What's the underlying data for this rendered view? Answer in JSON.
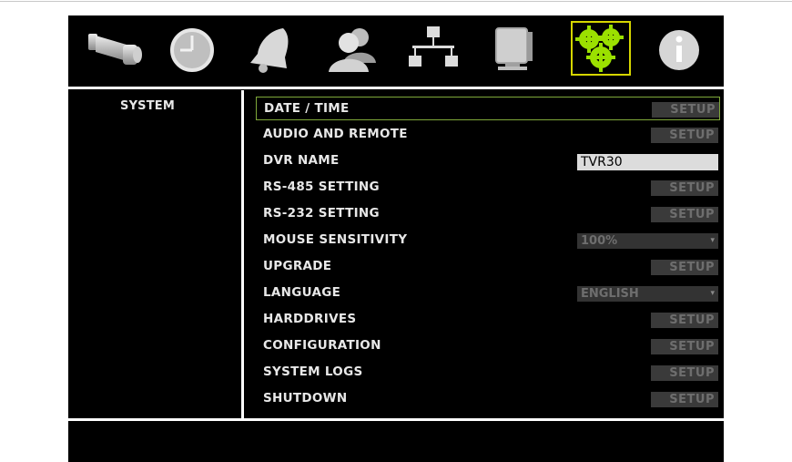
{
  "toolbar": {
    "icons": [
      "camera-icon",
      "clock-icon",
      "alarm-bell-icon",
      "users-icon",
      "network-icon",
      "display-monitor-icon",
      "system-gears-icon",
      "info-icon"
    ],
    "active": "system-gears-icon"
  },
  "sidebar": {
    "title": "SYSTEM"
  },
  "menu": {
    "items": [
      {
        "label": "DATE / TIME",
        "control": "button",
        "value": "SETUP"
      },
      {
        "label": "AUDIO AND REMOTE",
        "control": "button",
        "value": "SETUP"
      },
      {
        "label": "DVR NAME",
        "control": "text",
        "value": "TVR30"
      },
      {
        "label": "RS-485 SETTING",
        "control": "button",
        "value": "SETUP"
      },
      {
        "label": "RS-232 SETTING",
        "control": "button",
        "value": "SETUP"
      },
      {
        "label": "MOUSE SENSITIVITY",
        "control": "select",
        "value": "100%"
      },
      {
        "label": "UPGRADE",
        "control": "button",
        "value": "SETUP"
      },
      {
        "label": "LANGUAGE",
        "control": "select",
        "value": "ENGLISH"
      },
      {
        "label": "HARDDRIVES",
        "control": "button",
        "value": "SETUP"
      },
      {
        "label": "CONFIGURATION",
        "control": "button",
        "value": "SETUP"
      },
      {
        "label": "SYSTEM LOGS",
        "control": "button",
        "value": "SETUP"
      },
      {
        "label": "SHUTDOWN",
        "control": "button",
        "value": "SETUP"
      }
    ]
  },
  "colors": {
    "background": "#000000",
    "highlight_border": "#7fa83a",
    "active_icon": "#9be000"
  }
}
